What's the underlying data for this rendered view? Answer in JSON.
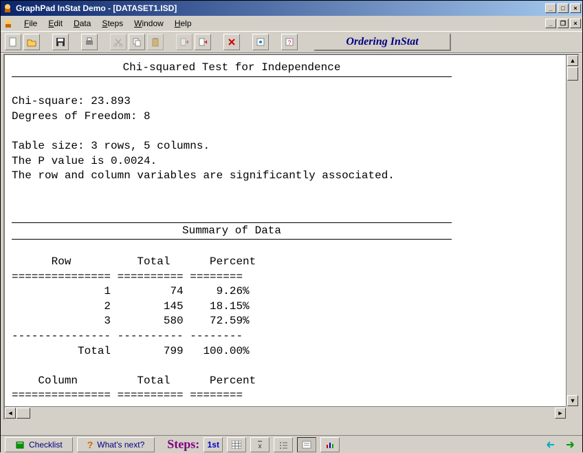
{
  "window": {
    "title": "GraphPad InStat Demo - [DATASET1.ISD]"
  },
  "menu": {
    "items": [
      "File",
      "Edit",
      "Data",
      "Steps",
      "Window",
      "Help"
    ]
  },
  "toolbar": {
    "ordering_label": "Ordering InStat"
  },
  "content": {
    "section1_title": "Chi-squared Test for Independence",
    "chi_line": "Chi-square: 23.893",
    "dof_line": "Degrees of Freedom: 8",
    "table_size_line": "Table size: 3 rows, 5 columns.",
    "pvalue_line": "The P value is 0.0024.",
    "assoc_line": "The row and column variables are significantly associated.",
    "section2_title": "Summary of Data",
    "row_header": "      Row          Total      Percent",
    "row_rule1": "=============== ========== ========",
    "row_data": [
      "              1         74     9.26%",
      "              2        145    18.15%",
      "              3        580    72.59%"
    ],
    "row_rule2": "--------------- ---------- --------",
    "row_total": "          Total        799   100.00%",
    "col_header": "    Column         Total      Percent",
    "col_rule": "=============== ========== ========"
  },
  "bottom": {
    "checklist_label": "Checklist",
    "whatsnext_label": "What's next?",
    "steps_label": "Steps:",
    "first_label": "1st"
  },
  "chart_data": {
    "type": "table",
    "title": "Chi-squared Test for Independence",
    "stats": {
      "chi_square": 23.893,
      "degrees_of_freedom": 8,
      "rows": 3,
      "columns": 5,
      "p_value": 0.0024,
      "conclusion": "significantly associated"
    },
    "row_summary": {
      "columns": [
        "Row",
        "Total",
        "Percent"
      ],
      "data": [
        {
          "row": 1,
          "total": 74,
          "percent": 9.26
        },
        {
          "row": 2,
          "total": 145,
          "percent": 18.15
        },
        {
          "row": 3,
          "total": 580,
          "percent": 72.59
        }
      ],
      "grand_total": {
        "total": 799,
        "percent": 100.0
      }
    }
  }
}
